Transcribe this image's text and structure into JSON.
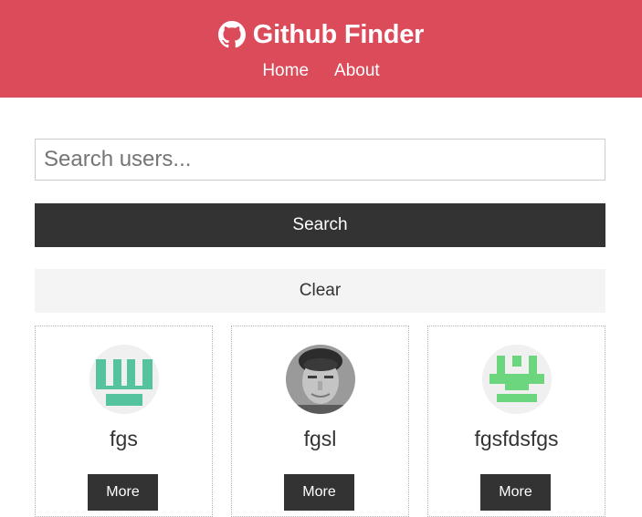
{
  "app": {
    "title": "Github Finder",
    "brand_icon": "github-icon",
    "accent_color": "#dc4b5a"
  },
  "nav": {
    "links": [
      {
        "label": "Home"
      },
      {
        "label": "About"
      }
    ]
  },
  "search": {
    "placeholder": "Search users...",
    "value": "",
    "submit_label": "Search",
    "clear_label": "Clear"
  },
  "users": [
    {
      "login": "fgs",
      "avatar_icon": "identicon-teal",
      "avatar_color": "#55c39e",
      "more_label": "More"
    },
    {
      "login": "fgsl",
      "avatar_icon": "user-photo",
      "avatar_color": "#8a8a8a",
      "more_label": "More"
    },
    {
      "login": "fgsfdsfgs",
      "avatar_icon": "identicon-green",
      "avatar_color": "#6cd67e",
      "more_label": "More"
    }
  ]
}
